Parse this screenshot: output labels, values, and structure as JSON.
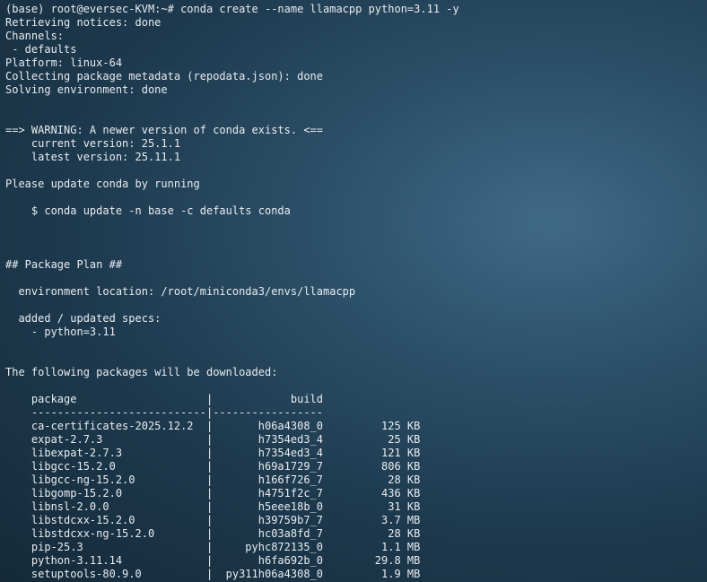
{
  "terminal": {
    "lines": [
      "(base) root@eversec-KVM:~# conda create --name llamacpp python=3.11 -y",
      "Retrieving notices: done",
      "Channels:",
      " - defaults",
      "Platform: linux-64",
      "Collecting package metadata (repodata.json): done",
      "Solving environment: done",
      "",
      "",
      "==> WARNING: A newer version of conda exists. <==",
      "    current version: 25.1.1",
      "    latest version: 25.11.1",
      "",
      "Please update conda by running",
      "",
      "    $ conda update -n base -c defaults conda",
      "",
      "",
      "",
      "## Package Plan ##",
      "",
      "  environment location: /root/miniconda3/envs/llamacpp",
      "",
      "  added / updated specs:",
      "    - python=3.11",
      "",
      "",
      "The following packages will be downloaded:",
      "",
      "    package                    |            build",
      "    ---------------------------|-----------------",
      "    ca-certificates-2025.12.2  |       h06a4308_0         125 KB",
      "    expat-2.7.3                |       h7354ed3_4          25 KB",
      "    libexpat-2.7.3             |       h7354ed3_4         121 KB",
      "    libgcc-15.2.0              |       h69a1729_7         806 KB",
      "    libgcc-ng-15.2.0           |       h166f726_7          28 KB",
      "    libgomp-15.2.0             |       h4751f2c_7         436 KB",
      "    libnsl-2.0.0               |       h5eee18b_0          31 KB",
      "    libstdcxx-15.2.0           |       h39759b7_7         3.7 MB",
      "    libstdcxx-ng-15.2.0        |       hc03a8fd_7          28 KB",
      "    pip-25.3                   |     pyhc872135_0         1.1 MB",
      "    python-3.11.14             |       h6fa692b_0        29.8 MB",
      "    setuptools-80.9.0          |  py311h06a4308_0         1.9 MB"
    ]
  }
}
